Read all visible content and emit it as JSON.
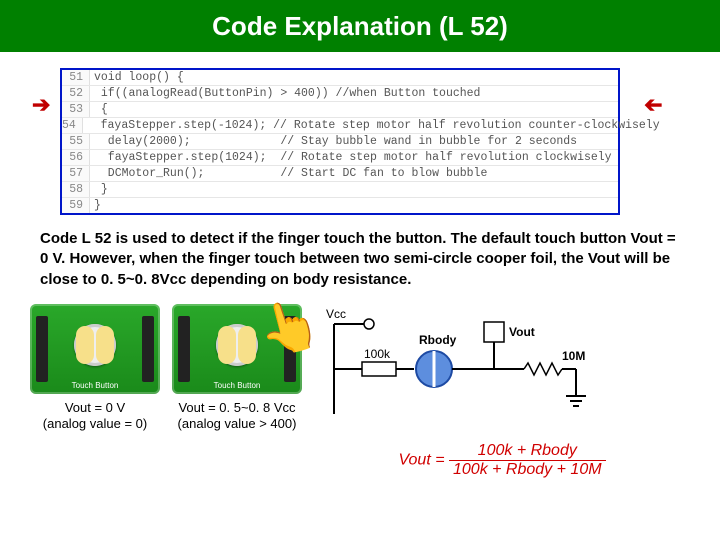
{
  "title": "Code Explanation (L 52)",
  "code": {
    "lines": [
      {
        "n": "51",
        "t": "void loop() {"
      },
      {
        "n": "52",
        "t": " if((analogRead(ButtonPin) > 400)) //when Button touched"
      },
      {
        "n": "53",
        "t": " {"
      },
      {
        "n": "54",
        "t": "  fayaStepper.step(-1024); // Rotate step motor half revolution counter-clockwisely"
      },
      {
        "n": "55",
        "t": "  delay(2000);             // Stay bubble wand in bubble for 2 seconds"
      },
      {
        "n": "56",
        "t": "  fayaStepper.step(1024);  // Rotate step motor half revolution clockwisely"
      },
      {
        "n": "57",
        "t": "  DCMotor_Run();           // Start DC fan to blow bubble"
      },
      {
        "n": "58",
        "t": " }"
      },
      {
        "n": "59",
        "t": "}"
      }
    ]
  },
  "body_text": "Code L 52 is used to detect if the finger touch the button.  The default touch button Vout = 0 V.  However, when the finger touch between two semi-circle cooper foil, the Vout will be close to 0. 5~0. 8Vcc depending on body resistance.",
  "fig1": {
    "board_label": "Touch Button",
    "caption_line1": "Vout = 0 V",
    "caption_line2": "(analog value = 0)"
  },
  "fig2": {
    "board_label": "Touch Button",
    "caption_line1": "Vout = 0. 5~0. 8 Vcc",
    "caption_line2": "(analog value > 400)"
  },
  "circuit": {
    "vcc": "Vcc",
    "r100k": "100k",
    "rbody": "Rbody",
    "vout": "Vout",
    "r10m": "10M"
  },
  "formula": {
    "lhs": "Vout =",
    "num": "100k + Rbody",
    "den": "100k + Rbody + 10M"
  }
}
